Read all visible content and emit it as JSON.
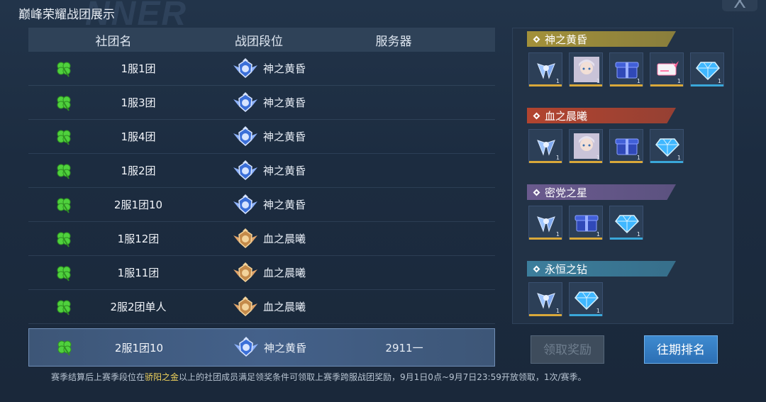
{
  "window": {
    "title": "巅峰荣耀战团展示",
    "watermark": "NNER",
    "close_label": "X"
  },
  "table": {
    "headers": {
      "name": "社团名",
      "rank": "战团段位",
      "server": "服务器"
    },
    "rows": [
      {
        "name": "1服1团",
        "rank": "神之黄昏",
        "server": "",
        "tier": "gold"
      },
      {
        "name": "1服3团",
        "rank": "神之黄昏",
        "server": "",
        "tier": "gold"
      },
      {
        "name": "1服4团",
        "rank": "神之黄昏",
        "server": "",
        "tier": "gold"
      },
      {
        "name": "1服2团",
        "rank": "神之黄昏",
        "server": "",
        "tier": "gold"
      },
      {
        "name": "2服1团10",
        "rank": "神之黄昏",
        "server": "",
        "tier": "gold"
      },
      {
        "name": "1服12团",
        "rank": "血之晨曦",
        "server": "",
        "tier": "red"
      },
      {
        "name": "1服11团",
        "rank": "血之晨曦",
        "server": "",
        "tier": "red"
      },
      {
        "name": "2服2团单人",
        "rank": "血之晨曦",
        "server": "",
        "tier": "red"
      }
    ],
    "selected_row": {
      "name": "2服1团10",
      "rank": "神之黄昏",
      "server": "2911一"
    }
  },
  "rewards": {
    "tiers": [
      {
        "label": "神之黄昏",
        "color": "#a3913a",
        "items": [
          {
            "icon": "wing-emblem-icon",
            "qty": "1",
            "bar": "#d9a83a"
          },
          {
            "icon": "character-portrait-icon",
            "qty": "1",
            "bar": "#d9a83a"
          },
          {
            "icon": "gift-box-icon",
            "qty": "1",
            "bar": "#d9a83a"
          },
          {
            "icon": "ribbon-ticket-icon",
            "qty": "1",
            "bar": "#d9a83a"
          },
          {
            "icon": "diamond-icon",
            "qty": "1",
            "bar": "#3aa7d9"
          }
        ]
      },
      {
        "label": "血之晨曦",
        "color": "#b2442f",
        "items": [
          {
            "icon": "wing-emblem-icon",
            "qty": "1",
            "bar": "#d9a83a"
          },
          {
            "icon": "character-portrait-icon",
            "qty": "1",
            "bar": "#d9a83a"
          },
          {
            "icon": "gift-box-icon",
            "qty": "1",
            "bar": "#d9a83a"
          },
          {
            "icon": "diamond-icon",
            "qty": "1",
            "bar": "#3aa7d9"
          }
        ]
      },
      {
        "label": "密党之星",
        "color": "#6a5a8e",
        "items": [
          {
            "icon": "wing-emblem-icon",
            "qty": "1",
            "bar": "#d9a83a"
          },
          {
            "icon": "gift-box-icon",
            "qty": "1",
            "bar": "#d9a83a"
          },
          {
            "icon": "diamond-icon",
            "qty": "1",
            "bar": "#3aa7d9"
          }
        ]
      },
      {
        "label": "永恒之钻",
        "color": "#3c7e9c",
        "items": [
          {
            "icon": "wing-emblem-icon",
            "qty": "1",
            "bar": "#d9a83a"
          },
          {
            "icon": "diamond-icon",
            "qty": "1",
            "bar": "#3aa7d9"
          }
        ]
      }
    ]
  },
  "buttons": {
    "claim": "领取奖励",
    "history": "往期排名"
  },
  "footnote": {
    "before": "赛季结算后上赛季段位在",
    "highlight": "骄阳之金",
    "after": "以上的社团成员满足领奖条件可领取上赛季跨服战团奖励，9月1日0点~9月7日23:59开放领取，1次/赛季。"
  }
}
